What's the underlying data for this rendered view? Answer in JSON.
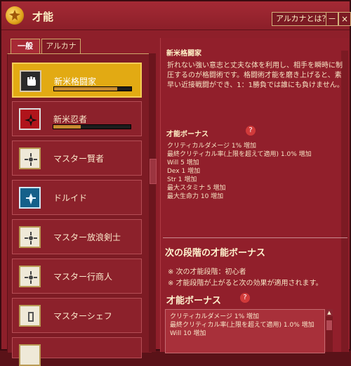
{
  "window": {
    "title": "才能",
    "arcana_button": "アルカナとは？",
    "minimize": "－",
    "close": "×"
  },
  "tabs": [
    {
      "label": "一般",
      "active": true
    },
    {
      "label": "アルカナ",
      "active": false
    }
  ],
  "talents": [
    {
      "name": "新米格闘家",
      "icon": "fist-icon",
      "selected": true,
      "progress": 0.82
    },
    {
      "name": "新米忍者",
      "icon": "shuriken-icon",
      "selected": false,
      "progress": 0.35
    },
    {
      "name": "マスター賢者",
      "icon": "sage-icon",
      "selected": false
    },
    {
      "name": "ドルイド",
      "icon": "druid-icon",
      "selected": false
    },
    {
      "name": "マスター放浪剣士",
      "icon": "sword-icon",
      "selected": false
    },
    {
      "name": "マスター行商人",
      "icon": "merchant-icon",
      "selected": false
    },
    {
      "name": "マスターシェフ",
      "icon": "chef-icon",
      "selected": false
    }
  ],
  "detail": {
    "title": "新米格闘家",
    "description": "折れない強い意志と丈夫な体を利用し、相手を瞬時に制圧するのが格闘術です。格闘術才能を磨き上げると、素早い近接戦闘ができ、1：1勝負では誰にも負けません。",
    "bonus_title": "才能ボーナス",
    "bonus_help": "?",
    "bonuses": [
      "クリティカルダメージ 1% 増加",
      "最終クリティカル率(上限を超えて適用) 1.0% 増加",
      "Will 5 増加",
      "Dex 1 増加",
      "Str 1 増加",
      "最大スタミナ 5 増加",
      "最大生命力 10 増加"
    ]
  },
  "next_stage": {
    "title": "次の段階の才能ボーナス",
    "bullets": [
      "次の才能段階：初心者",
      "才能段階が上がると次の効果が適用されます。"
    ],
    "bonus_title": "才能ボーナス",
    "bonuses": [
      "クリティカルダメージ 1% 増加",
      "最終クリティカル率(上限を超えて適用) 1.0% 増加",
      "Will 10 増加"
    ]
  }
}
